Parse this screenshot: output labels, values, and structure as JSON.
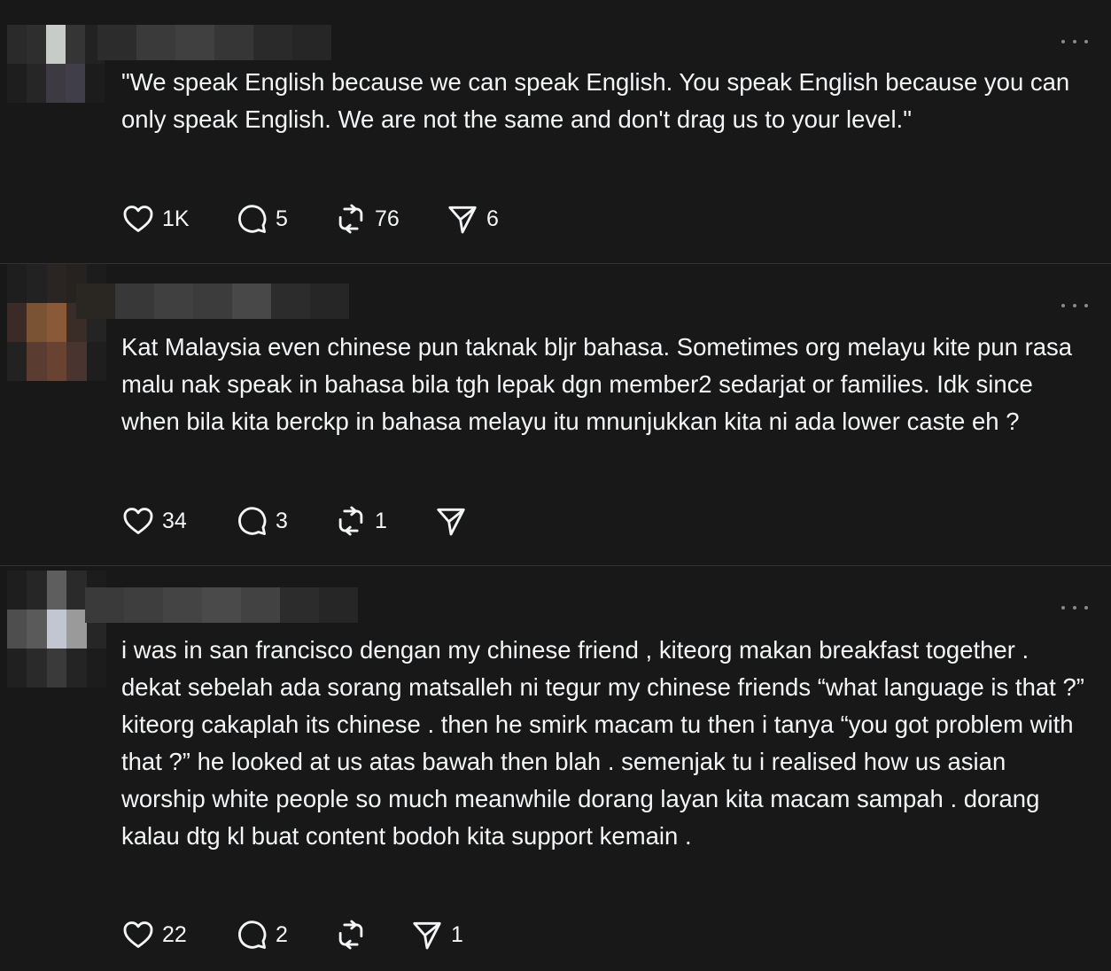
{
  "more_icon": "ellipsis-icon",
  "posts": [
    {
      "text": "\"We speak English because we can speak English. You speak English because you can only speak English. We are not the same and don't drag us to your level.\"",
      "likes": "1K",
      "replies": "5",
      "reposts": "76",
      "shares": "6"
    },
    {
      "text": "Kat Malaysia even chinese pun taknak bljr bahasa. Sometimes org melayu kite pun rasa malu nak speak in bahasa bila tgh lepak dgn member2 sedarjat or families. Idk since when bila kita berckp in bahasa melayu itu mnunjukkan kita ni ada lower caste eh ?",
      "likes": "34",
      "replies": "3",
      "reposts": "1",
      "shares": ""
    },
    {
      "text": "i was in san francisco dengan my chinese friend , kiteorg makan breakfast together . dekat sebelah ada sorang matsalleh ni tegur my chinese friends “what language is that ?” kiteorg cakaplah its chinese . then he smirk macam tu then i tanya “you got problem with that ?” he looked at us atas bawah then blah . semenjak tu i realised how us asian worship white people so much meanwhile dorang layan kita macam sampah . dorang kalau dtg kl buat content bodoh kita support kemain .",
      "likes": "22",
      "replies": "2",
      "reposts": "",
      "shares": "1"
    }
  ]
}
